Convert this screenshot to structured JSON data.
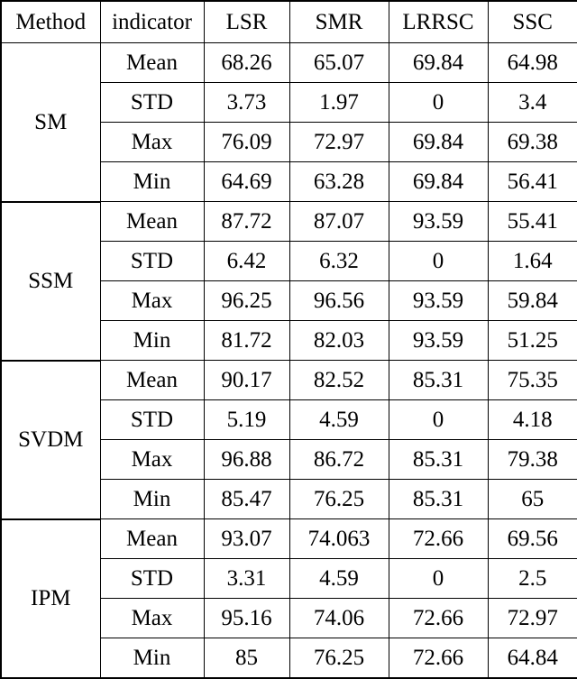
{
  "table": {
    "columns": [
      "Method",
      "indicator",
      "LSR",
      "SMR",
      "LRRSC",
      "SSC"
    ],
    "indicators": [
      "Mean",
      "STD",
      "Max",
      "Min"
    ],
    "blocks": [
      {
        "method": "SM",
        "rows": [
          {
            "indicator": "Mean",
            "LSR": "68.26",
            "SMR": "65.07",
            "LRRSC": "69.84",
            "SSC": "64.98",
            "bold": {
              "LSR": false,
              "SMR": false,
              "LRRSC": false,
              "SSC": false
            }
          },
          {
            "indicator": "STD",
            "LSR": "3.73",
            "SMR": "1.97",
            "LRRSC": "0",
            "SSC": "3.4",
            "bold": {
              "LSR": false,
              "SMR": false,
              "LRRSC": true,
              "SSC": false
            }
          },
          {
            "indicator": "Max",
            "LSR": "76.09",
            "SMR": "72.97",
            "LRRSC": "69.84",
            "SSC": "69.38",
            "bold": {
              "LSR": false,
              "SMR": false,
              "LRRSC": false,
              "SSC": false
            }
          },
          {
            "indicator": "Min",
            "LSR": "64.69",
            "SMR": "63.28",
            "LRRSC": "69.84",
            "SSC": "56.41",
            "bold": {
              "LSR": false,
              "SMR": false,
              "LRRSC": false,
              "SSC": false
            }
          }
        ]
      },
      {
        "method": "SSM",
        "rows": [
          {
            "indicator": "Mean",
            "LSR": "87.72",
            "SMR": "87.07",
            "LRRSC": "93.59",
            "SSC": "55.41",
            "bold": {
              "LSR": false,
              "SMR": false,
              "LRRSC": true,
              "SSC": false
            }
          },
          {
            "indicator": "STD",
            "LSR": "6.42",
            "SMR": "6.32",
            "LRRSC": "0",
            "SSC": "1.64",
            "bold": {
              "LSR": false,
              "SMR": false,
              "LRRSC": true,
              "SSC": false
            }
          },
          {
            "indicator": "Max",
            "LSR": "96.25",
            "SMR": "96.56",
            "LRRSC": "93.59",
            "SSC": "59.84",
            "bold": {
              "LSR": false,
              "SMR": false,
              "LRRSC": false,
              "SSC": false
            }
          },
          {
            "indicator": "Min",
            "LSR": "81.72",
            "SMR": "82.03",
            "LRRSC": "93.59",
            "SSC": "51.25",
            "bold": {
              "LSR": false,
              "SMR": false,
              "LRRSC": false,
              "SSC": false
            }
          }
        ]
      },
      {
        "method": "SVDM",
        "rows": [
          {
            "indicator": "Mean",
            "LSR": "90.17",
            "SMR": "82.52",
            "LRRSC": "85.31",
            "SSC": "75.35",
            "bold": {
              "LSR": false,
              "SMR": false,
              "LRRSC": false,
              "SSC": false
            }
          },
          {
            "indicator": "STD",
            "LSR": "5.19",
            "SMR": "4.59",
            "LRRSC": "0",
            "SSC": "4.18",
            "bold": {
              "LSR": false,
              "SMR": false,
              "LRRSC": true,
              "SSC": false
            }
          },
          {
            "indicator": "Max",
            "LSR": "96.88",
            "SMR": "86.72",
            "LRRSC": "85.31",
            "SSC": "79.38",
            "bold": {
              "LSR": false,
              "SMR": false,
              "LRRSC": false,
              "SSC": false
            }
          },
          {
            "indicator": "Min",
            "LSR": "85.47",
            "SMR": "76.25",
            "LRRSC": "85.31",
            "SSC": "65",
            "bold": {
              "LSR": false,
              "SMR": false,
              "LRRSC": false,
              "SSC": false
            }
          }
        ]
      },
      {
        "method": "IPM",
        "rows": [
          {
            "indicator": "Mean",
            "LSR": "93.07",
            "SMR": "74.063",
            "LRRSC": "72.66",
            "SSC": "69.56",
            "bold": {
              "LSR": false,
              "SMR": false,
              "LRRSC": false,
              "SSC": false
            }
          },
          {
            "indicator": "STD",
            "LSR": "3.31",
            "SMR": "4.59",
            "LRRSC": "0",
            "SSC": "2.5",
            "bold": {
              "LSR": false,
              "SMR": false,
              "LRRSC": true,
              "SSC": false
            }
          },
          {
            "indicator": "Max",
            "LSR": "95.16",
            "SMR": "74.06",
            "LRRSC": "72.66",
            "SSC": "72.97",
            "bold": {
              "LSR": false,
              "SMR": false,
              "LRRSC": false,
              "SSC": false
            }
          },
          {
            "indicator": "Min",
            "LSR": "85",
            "SMR": "76.25",
            "LRRSC": "72.66",
            "SSC": "64.84",
            "bold": {
              "LSR": false,
              "SMR": false,
              "LRRSC": false,
              "SSC": false
            }
          }
        ]
      }
    ]
  }
}
